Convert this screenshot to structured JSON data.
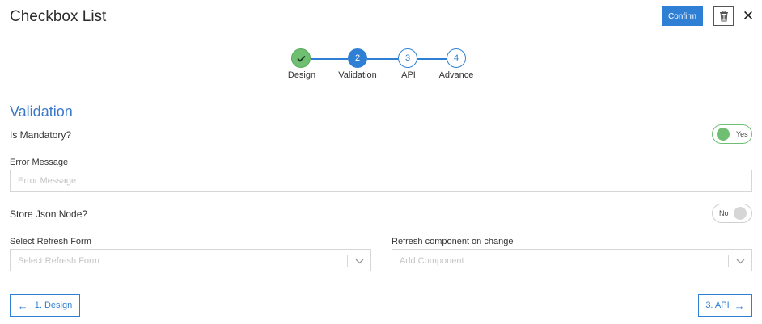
{
  "header": {
    "title": "Checkbox List",
    "confirm_label": "Confirm",
    "trash_icon": "trash-icon",
    "close_symbol": "✕"
  },
  "stepper": {
    "steps": [
      {
        "number": "✓",
        "label": "Design",
        "state": "done"
      },
      {
        "number": "2",
        "label": "Validation",
        "state": "active"
      },
      {
        "number": "3",
        "label": "API",
        "state": "pending"
      },
      {
        "number": "4",
        "label": "Advance",
        "state": "pending"
      }
    ]
  },
  "section": {
    "title": "Validation"
  },
  "mandatory": {
    "label": "Is Mandatory?",
    "toggle_text": "Yes"
  },
  "error_message": {
    "label": "Error Message",
    "placeholder": "Error Message",
    "value": ""
  },
  "store_json": {
    "label": "Store Json Node?",
    "toggle_text": "No"
  },
  "refresh_form": {
    "label": "Select Refresh Form",
    "placeholder": "Select Refresh Form"
  },
  "refresh_component": {
    "label": "Refresh component on change",
    "placeholder": "Add Component"
  },
  "footer": {
    "back_label": "1. Design",
    "back_arrow": "←",
    "next_label": "3. API",
    "next_arrow": "→"
  },
  "colors": {
    "primary": "#2f7fd4",
    "success": "#6fbf73",
    "section_title": "#3a78c9"
  }
}
